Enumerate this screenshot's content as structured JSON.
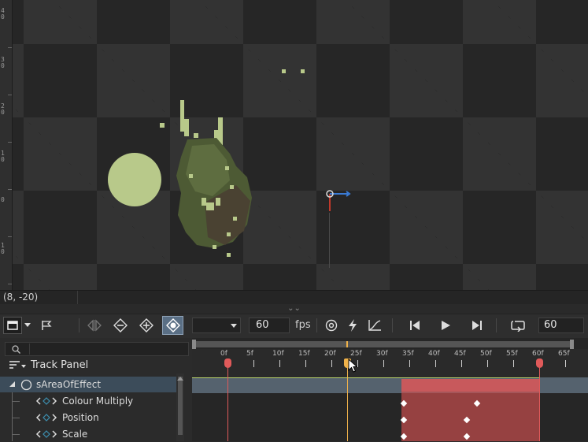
{
  "viewport": {
    "ruler_labels": [
      "4\n0",
      "3\n0",
      "2\n0",
      "1\n0",
      "0",
      "1\n0"
    ],
    "coordinate_readout": "(8, -20)"
  },
  "splitter": {
    "glyph": "⌄⌄"
  },
  "toolbar": {
    "fps_value": "60",
    "fps_label": "fps",
    "end_frame_value": "60"
  },
  "track_panel": {
    "title": "Track Panel",
    "search_placeholder": "",
    "asset_name": "sAreaOfEffect",
    "tracks": [
      {
        "label": "Colour Multiply"
      },
      {
        "label": "Position"
      },
      {
        "label": "Scale"
      }
    ]
  },
  "timeline": {
    "frame_labels": [
      "0f",
      "5f",
      "10f",
      "15f",
      "20f",
      "25f",
      "30f",
      "35f",
      "40f",
      "45f",
      "50f",
      "55f",
      "60f",
      "65f"
    ],
    "playhead_frame": 23,
    "range_start_frame": 0,
    "range_end_frame": 60,
    "clip_start_frame": 34,
    "keyframes": [
      {
        "track": 0,
        "frames": [
          34,
          48
        ]
      },
      {
        "track": 1,
        "frames": [
          34,
          46
        ]
      },
      {
        "track": 2,
        "frames": [
          34,
          46
        ]
      }
    ]
  },
  "colors": {
    "accent_red": "#e05a5a",
    "playhead": "#f0b24a",
    "asset_track": "#55626e",
    "selection": "#3c4c5a",
    "sprite_green": "#b8c98a"
  }
}
